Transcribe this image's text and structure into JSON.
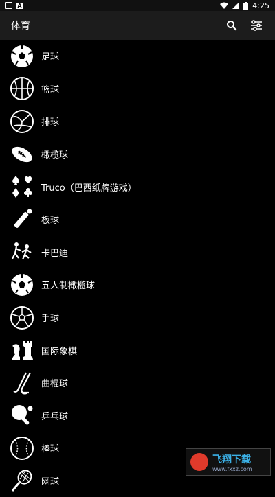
{
  "status_bar": {
    "time": "4:25"
  },
  "app_bar": {
    "title": "体育"
  },
  "items": [
    {
      "label": "足球",
      "icon": "soccer-ball-icon"
    },
    {
      "label": "篮球",
      "icon": "basketball-icon"
    },
    {
      "label": "排球",
      "icon": "volleyball-icon"
    },
    {
      "label": "橄榄球",
      "icon": "rugby-ball-icon"
    },
    {
      "label": "Truco（巴西纸牌游戏）",
      "icon": "card-suits-icon"
    },
    {
      "label": "板球",
      "icon": "cricket-bat-icon"
    },
    {
      "label": "卡巴迪",
      "icon": "kabaddi-players-icon"
    },
    {
      "label": "五人制橄榄球",
      "icon": "soccer-ball-icon"
    },
    {
      "label": "手球",
      "icon": "handball-icon"
    },
    {
      "label": "国际象棋",
      "icon": "chess-pieces-icon"
    },
    {
      "label": "曲棍球",
      "icon": "hockey-stick-icon"
    },
    {
      "label": "乒乓球",
      "icon": "table-tennis-icon"
    },
    {
      "label": "棒球",
      "icon": "baseball-icon"
    },
    {
      "label": "网球",
      "icon": "tennis-racket-icon"
    }
  ],
  "watermark": {
    "text": "飞翔下载",
    "url": "www.fxxz.com"
  }
}
